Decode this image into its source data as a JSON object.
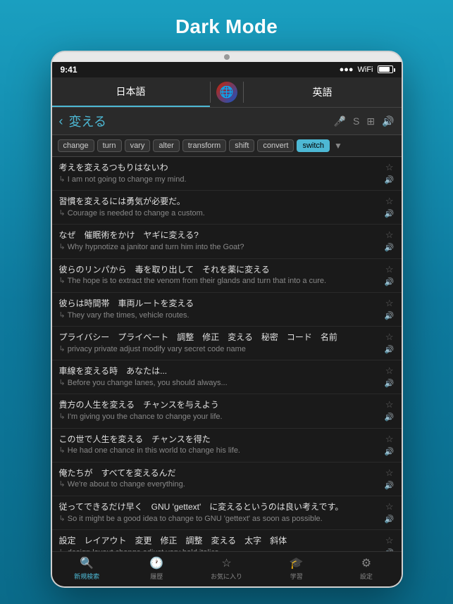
{
  "page": {
    "title": "Dark Mode"
  },
  "device": {
    "status": {
      "time": "9:41",
      "signal": "●●●●",
      "wifi": "WiFi",
      "battery": "100%"
    },
    "lang_tabs": {
      "left": "日本語",
      "right": "英語"
    },
    "search": {
      "query": "変える",
      "back_label": "<"
    },
    "tags": [
      {
        "label": "change",
        "active": false
      },
      {
        "label": "turn",
        "active": false
      },
      {
        "label": "vary",
        "active": false
      },
      {
        "label": "alter",
        "active": false
      },
      {
        "label": "transform",
        "active": false
      },
      {
        "label": "shift",
        "active": false
      },
      {
        "label": "convert",
        "active": false
      },
      {
        "label": "switch",
        "active": true
      }
    ],
    "results": [
      {
        "jp": "考えを変えるつもりはないわ",
        "en": "I am not going to change my mind."
      },
      {
        "jp": "習慣を変えるには勇気が必要だ。",
        "en": "Courage is needed to change a custom."
      },
      {
        "jp": "なぜ　催眠術をかけ　ヤギに変える?",
        "en": "Why hypnotize a janitor and turn him into the Goat?"
      },
      {
        "jp": "彼らのリンパから　毒を取り出して　それを薬に変える",
        "en": "The hope is to extract the venom from their glands and turn that into a cure."
      },
      {
        "jp": "彼らは時間帯　車両ルートを変える",
        "en": "They vary the times, vehicle routes."
      },
      {
        "jp": "プライバシー　プライベート　調整　修正　変える　秘密　コード　名前",
        "en": "privacy private adjust modify vary secret code name"
      },
      {
        "jp": "車線を変える時　あなたは...",
        "en": "Before you change lanes, you should always..."
      },
      {
        "jp": "貴方の人生を変える　チャンスを与えよう",
        "en": "I'm giving you the chance to change your life."
      },
      {
        "jp": "この世で人生を変える　チャンスを得た",
        "en": "He had one chance in this world to change his life."
      },
      {
        "jp": "俺たちが　すべてを変えるんだ",
        "en": "We're about to change everything."
      },
      {
        "jp": "従ってできるだけ早く　GNU 'gettext'　に変えるというのは良い考えです。",
        "en": "So it might be a good idea to change to GNU 'gettext' as soon as possible."
      },
      {
        "jp": "設定　レイアウト　変更　修正　調整　変える　太字　斜体",
        "en": "design layout change adjust vary bold italics"
      }
    ],
    "bottom_tabs": [
      {
        "label": "新規検索",
        "icon": "🔍",
        "active": true
      },
      {
        "label": "履歴",
        "icon": "🕐",
        "active": false
      },
      {
        "label": "お気に入り",
        "icon": "☆",
        "active": false
      },
      {
        "label": "学習",
        "icon": "🎓",
        "active": false
      },
      {
        "label": "設定",
        "icon": "⚙",
        "active": false
      }
    ]
  }
}
